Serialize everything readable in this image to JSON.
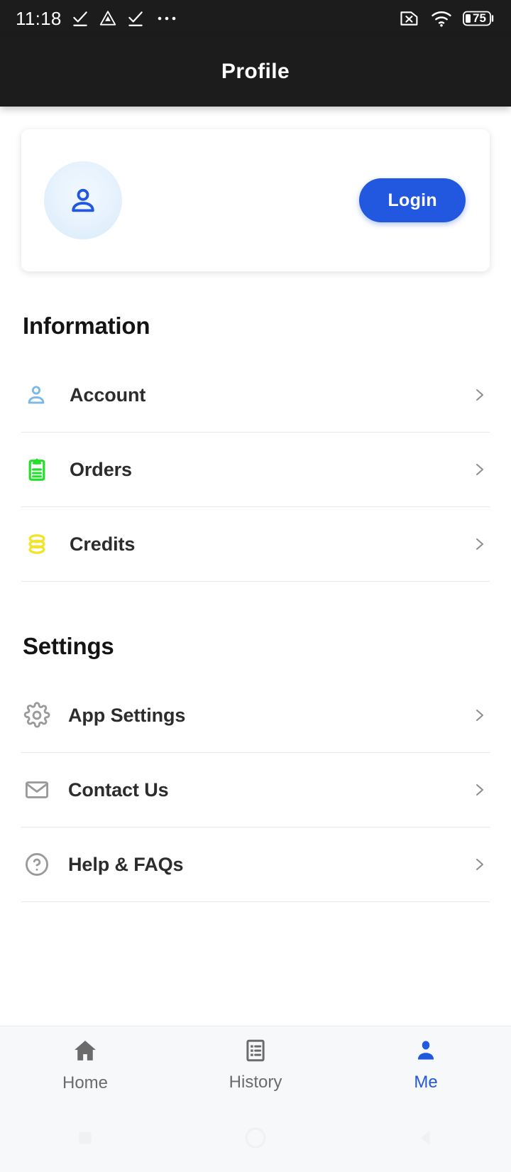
{
  "status_bar": {
    "time": "11:18",
    "left_icons": [
      {
        "name": "check-underline-icon"
      },
      {
        "name": "triangle-drop-icon"
      },
      {
        "name": "check-underline-icon"
      },
      {
        "name": "more-dots-icon"
      }
    ],
    "right_icons": [
      {
        "name": "sim-card-off-icon"
      },
      {
        "name": "wifi-icon"
      }
    ],
    "battery_level": "75"
  },
  "app_bar": {
    "title": "Profile"
  },
  "profile_card": {
    "avatar_icon": "person-icon",
    "login_label": "Login"
  },
  "sections": [
    {
      "title": "Information",
      "rows": [
        {
          "label": "Account",
          "icon": "person-outline-icon",
          "color": "#7ab8e8",
          "chevron": "chevron-right-icon"
        },
        {
          "label": "Orders",
          "icon": "clipboard-list-icon",
          "color": "#21e02a",
          "chevron": "chevron-right-icon"
        },
        {
          "label": "Credits",
          "icon": "coins-stack-icon",
          "color": "#f2e32c",
          "chevron": "chevron-right-icon"
        }
      ]
    },
    {
      "title": "Settings",
      "rows": [
        {
          "label": "App Settings",
          "icon": "gear-icon",
          "color": "#9a9a9a",
          "chevron": "chevron-right-icon"
        },
        {
          "label": "Contact Us",
          "icon": "envelope-icon",
          "color": "#9a9a9a",
          "chevron": "chevron-right-icon"
        },
        {
          "label": "Help & FAQs",
          "icon": "question-circle-icon",
          "color": "#9a9a9a",
          "chevron": "chevron-right-icon"
        }
      ]
    }
  ],
  "bottom_nav": {
    "items": [
      {
        "label": "Home",
        "icon": "home-icon",
        "active": false
      },
      {
        "label": "History",
        "icon": "list-document-icon",
        "active": false
      },
      {
        "label": "Me",
        "icon": "person-filled-icon",
        "active": true
      }
    ],
    "active_color": "#2257e0",
    "inactive_color": "#6b6b6b"
  },
  "system_nav": {
    "buttons": [
      {
        "name": "recents-square-button"
      },
      {
        "name": "home-circle-button"
      },
      {
        "name": "back-triangle-button"
      }
    ]
  }
}
